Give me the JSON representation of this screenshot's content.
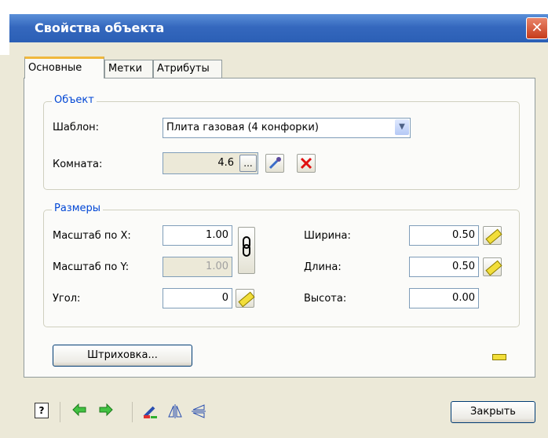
{
  "window": {
    "title": "Свойства объекта",
    "close_symbol": "✕"
  },
  "tabs": [
    {
      "label": "Основные",
      "active": true
    },
    {
      "label": "Метки",
      "active": false
    },
    {
      "label": "Атрибуты",
      "active": false
    }
  ],
  "object_group": {
    "title": "Объект",
    "template_label": "Шаблон:",
    "template_value": "Плита газовая (4 конфорки)",
    "room_label": "Комната:",
    "room_value": "4.6",
    "room_browse": "..."
  },
  "sizes_group": {
    "title": "Размеры",
    "scale_x_label": "Масштаб по X:",
    "scale_x_value": "1.00",
    "scale_y_label": "Масштаб по Y:",
    "scale_y_value": "1.00",
    "angle_label": "Угол:",
    "angle_value": "0",
    "width_label": "Ширина:",
    "width_value": "0.50",
    "length_label": "Длина:",
    "length_value": "0.50",
    "height_label": "Высота:",
    "height_value": "0.00"
  },
  "hatch_button": "Штриховка...",
  "close_button": "Закрыть",
  "colors": {
    "accent_tab": "#f0b83d",
    "title_bar": "#3568be",
    "group_title": "#0046d5"
  }
}
